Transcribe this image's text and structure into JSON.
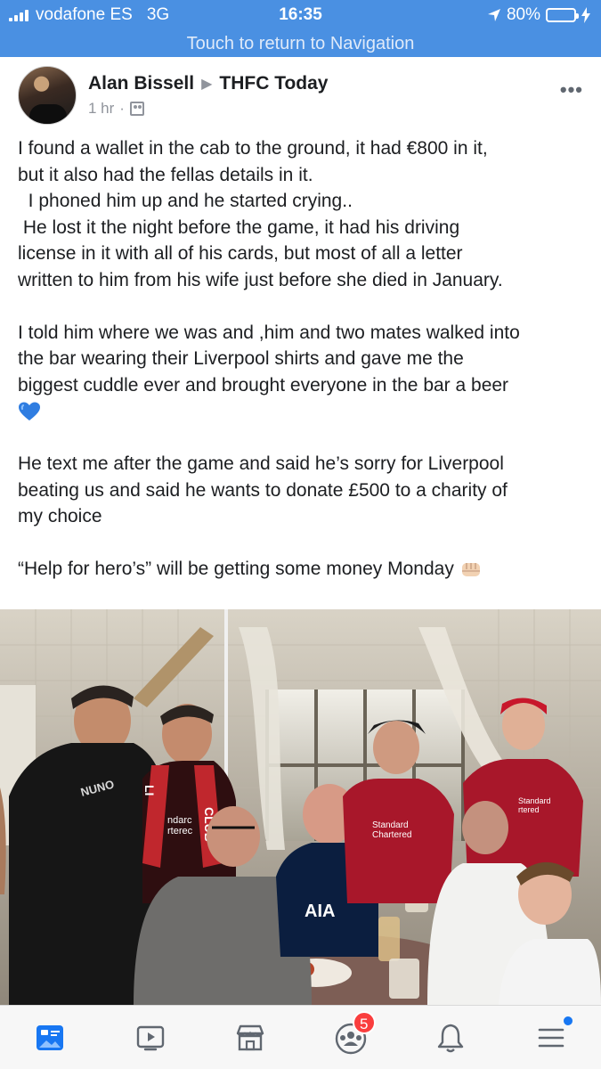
{
  "status": {
    "carrier": "vodafone ES",
    "network": "3G",
    "time": "16:35",
    "battery": "80%",
    "battery_level": 0.8,
    "return_text": "Touch to return to Navigation"
  },
  "post": {
    "author": "Alan Bissell",
    "group": "THFC Today",
    "time_ago": "1 hr",
    "separator": "·",
    "more": "•••",
    "paragraphs": [
      "I found a wallet in the cab to the ground, it had €800 in it,\nbut it also had the fellas details in it.\n  I phoned him up and he started crying..\n He lost it the night before the game, it had his driving\nlicense in it with all of his cards, but most of all a letter\nwritten to him from his wife just before she died in January.",
      "I told him where we was and ,him and two mates walked into\nthe bar wearing their Liverpool shirts and gave me the\nbiggest cuddle ever and brought everyone in the bar a beer",
      "He text me after the game and said he’s sorry for Liverpool\nbeating us and said he wants to donate £500 to a charity of\nmy choice",
      "“Help for hero’s” will be getting some money Monday"
    ],
    "emoji_heart": "blue-heart-icon",
    "emoji_fist": "fist-bump-icon"
  },
  "photo": {
    "shirt_text_sponsor": "Standard Chartered",
    "shirt_text_aia": "AIA",
    "scarf_text_left": "ndarc\nrterec",
    "scarf_text_right": "CLUB"
  },
  "tabbar": {
    "items": [
      {
        "name": "news-feed",
        "icon": "news-feed-icon"
      },
      {
        "name": "watch",
        "icon": "video-icon"
      },
      {
        "name": "marketplace",
        "icon": "marketplace-icon"
      },
      {
        "name": "groups",
        "icon": "groups-icon"
      },
      {
        "name": "notifications",
        "icon": "bell-icon"
      },
      {
        "name": "menu",
        "icon": "menu-icon"
      }
    ],
    "groups_badge": "5"
  },
  "colors": {
    "ios_blue": "#4a90e2",
    "fb_blue": "#1877f2",
    "badge_red": "#fa3e3e",
    "liverpool_red": "#a8172a",
    "tottenham_navy": "#0b1e3f"
  }
}
